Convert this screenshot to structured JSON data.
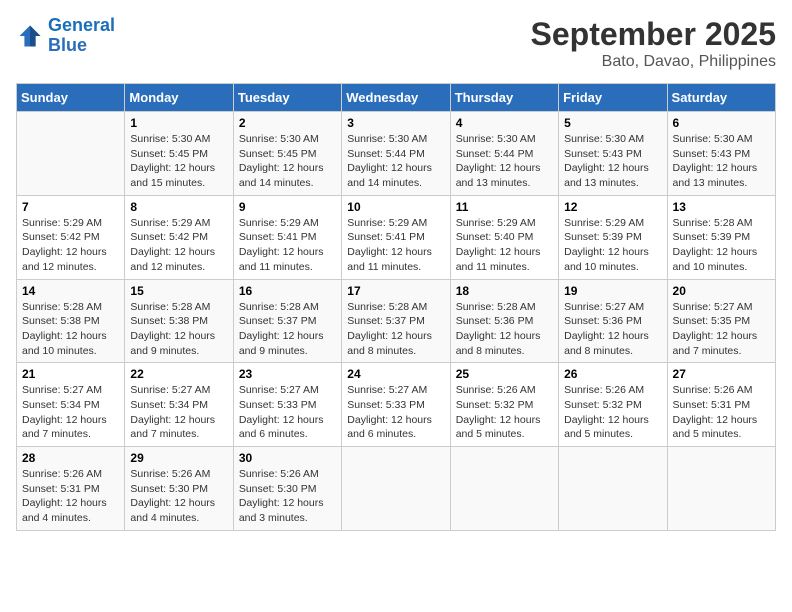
{
  "header": {
    "logo_line1": "General",
    "logo_line2": "Blue",
    "title": "September 2025",
    "subtitle": "Bato, Davao, Philippines"
  },
  "columns": [
    "Sunday",
    "Monday",
    "Tuesday",
    "Wednesday",
    "Thursday",
    "Friday",
    "Saturday"
  ],
  "weeks": [
    [
      {
        "day": "",
        "info": ""
      },
      {
        "day": "1",
        "info": "Sunrise: 5:30 AM\nSunset: 5:45 PM\nDaylight: 12 hours\nand 15 minutes."
      },
      {
        "day": "2",
        "info": "Sunrise: 5:30 AM\nSunset: 5:45 PM\nDaylight: 12 hours\nand 14 minutes."
      },
      {
        "day": "3",
        "info": "Sunrise: 5:30 AM\nSunset: 5:44 PM\nDaylight: 12 hours\nand 14 minutes."
      },
      {
        "day": "4",
        "info": "Sunrise: 5:30 AM\nSunset: 5:44 PM\nDaylight: 12 hours\nand 13 minutes."
      },
      {
        "day": "5",
        "info": "Sunrise: 5:30 AM\nSunset: 5:43 PM\nDaylight: 12 hours\nand 13 minutes."
      },
      {
        "day": "6",
        "info": "Sunrise: 5:30 AM\nSunset: 5:43 PM\nDaylight: 12 hours\nand 13 minutes."
      }
    ],
    [
      {
        "day": "7",
        "info": "Sunrise: 5:29 AM\nSunset: 5:42 PM\nDaylight: 12 hours\nand 12 minutes."
      },
      {
        "day": "8",
        "info": "Sunrise: 5:29 AM\nSunset: 5:42 PM\nDaylight: 12 hours\nand 12 minutes."
      },
      {
        "day": "9",
        "info": "Sunrise: 5:29 AM\nSunset: 5:41 PM\nDaylight: 12 hours\nand 11 minutes."
      },
      {
        "day": "10",
        "info": "Sunrise: 5:29 AM\nSunset: 5:41 PM\nDaylight: 12 hours\nand 11 minutes."
      },
      {
        "day": "11",
        "info": "Sunrise: 5:29 AM\nSunset: 5:40 PM\nDaylight: 12 hours\nand 11 minutes."
      },
      {
        "day": "12",
        "info": "Sunrise: 5:29 AM\nSunset: 5:39 PM\nDaylight: 12 hours\nand 10 minutes."
      },
      {
        "day": "13",
        "info": "Sunrise: 5:28 AM\nSunset: 5:39 PM\nDaylight: 12 hours\nand 10 minutes."
      }
    ],
    [
      {
        "day": "14",
        "info": "Sunrise: 5:28 AM\nSunset: 5:38 PM\nDaylight: 12 hours\nand 10 minutes."
      },
      {
        "day": "15",
        "info": "Sunrise: 5:28 AM\nSunset: 5:38 PM\nDaylight: 12 hours\nand 9 minutes."
      },
      {
        "day": "16",
        "info": "Sunrise: 5:28 AM\nSunset: 5:37 PM\nDaylight: 12 hours\nand 9 minutes."
      },
      {
        "day": "17",
        "info": "Sunrise: 5:28 AM\nSunset: 5:37 PM\nDaylight: 12 hours\nand 8 minutes."
      },
      {
        "day": "18",
        "info": "Sunrise: 5:28 AM\nSunset: 5:36 PM\nDaylight: 12 hours\nand 8 minutes."
      },
      {
        "day": "19",
        "info": "Sunrise: 5:27 AM\nSunset: 5:36 PM\nDaylight: 12 hours\nand 8 minutes."
      },
      {
        "day": "20",
        "info": "Sunrise: 5:27 AM\nSunset: 5:35 PM\nDaylight: 12 hours\nand 7 minutes."
      }
    ],
    [
      {
        "day": "21",
        "info": "Sunrise: 5:27 AM\nSunset: 5:34 PM\nDaylight: 12 hours\nand 7 minutes."
      },
      {
        "day": "22",
        "info": "Sunrise: 5:27 AM\nSunset: 5:34 PM\nDaylight: 12 hours\nand 7 minutes."
      },
      {
        "day": "23",
        "info": "Sunrise: 5:27 AM\nSunset: 5:33 PM\nDaylight: 12 hours\nand 6 minutes."
      },
      {
        "day": "24",
        "info": "Sunrise: 5:27 AM\nSunset: 5:33 PM\nDaylight: 12 hours\nand 6 minutes."
      },
      {
        "day": "25",
        "info": "Sunrise: 5:26 AM\nSunset: 5:32 PM\nDaylight: 12 hours\nand 5 minutes."
      },
      {
        "day": "26",
        "info": "Sunrise: 5:26 AM\nSunset: 5:32 PM\nDaylight: 12 hours\nand 5 minutes."
      },
      {
        "day": "27",
        "info": "Sunrise: 5:26 AM\nSunset: 5:31 PM\nDaylight: 12 hours\nand 5 minutes."
      }
    ],
    [
      {
        "day": "28",
        "info": "Sunrise: 5:26 AM\nSunset: 5:31 PM\nDaylight: 12 hours\nand 4 minutes."
      },
      {
        "day": "29",
        "info": "Sunrise: 5:26 AM\nSunset: 5:30 PM\nDaylight: 12 hours\nand 4 minutes."
      },
      {
        "day": "30",
        "info": "Sunrise: 5:26 AM\nSunset: 5:30 PM\nDaylight: 12 hours\nand 3 minutes."
      },
      {
        "day": "",
        "info": ""
      },
      {
        "day": "",
        "info": ""
      },
      {
        "day": "",
        "info": ""
      },
      {
        "day": "",
        "info": ""
      }
    ]
  ]
}
